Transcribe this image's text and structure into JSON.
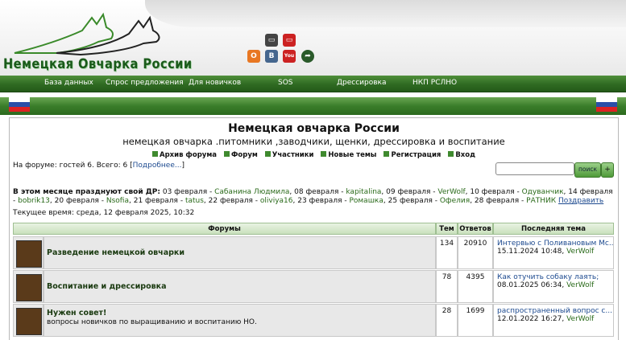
{
  "header": {
    "site_title": "Немецкая Овчарка России",
    "social_icons": [
      {
        "name": "tv-icon",
        "color": "#444444",
        "glyph": "▭"
      },
      {
        "name": "youtube-icon-top",
        "color": "#cc2222",
        "glyph": "▭"
      },
      {
        "name": "odnoklassniki-icon",
        "color": "#e87722",
        "glyph": "О"
      },
      {
        "name": "vkontakte-icon",
        "color": "#45668e",
        "glyph": "В"
      },
      {
        "name": "youtube-icon",
        "color": "#cc2222",
        "glyph": "You"
      },
      {
        "name": "share-icon",
        "color": "#2a5a2a",
        "glyph": "➦"
      }
    ]
  },
  "nav": {
    "items": [
      "База данных",
      "Спрос предложения",
      "Для новичков",
      "SOS",
      "Дрессировка",
      "НКП РСЛНО"
    ]
  },
  "forum": {
    "title": "Немецкая овчарка России",
    "description": "немецкая овчарка .питомники ,заводчики, щенки, дрессировка и воспитание",
    "top_links": [
      "Архив форума",
      "Форум",
      "Участники",
      "Новые темы",
      "Регистрация",
      "Вход"
    ],
    "online_text": "На форуме: гостей 6. Всего: 6 [",
    "online_more": "Подробнее...",
    "online_close": "]",
    "search_button": "поиск",
    "plus_button": "+",
    "birthdays_label": "В этом месяце празднуют свой ДР:",
    "birthdays": [
      {
        "date": "03 февраля",
        "user": "Сабанина Людмила"
      },
      {
        "date": "08 февраля",
        "user": "kapitalina"
      },
      {
        "date": "09 февраля",
        "user": "VerWolf"
      },
      {
        "date": "10 февраля",
        "user": "Одуванчик"
      },
      {
        "date": "14 февраля",
        "user": "bobrik13"
      },
      {
        "date": "20 февраля",
        "user": "Nsofia"
      },
      {
        "date": "21 февраля",
        "user": "tatus"
      },
      {
        "date": "22 февраля",
        "user": "oliviya16"
      },
      {
        "date": "23 февраля",
        "user": "Ромашка"
      },
      {
        "date": "25 февраля",
        "user": "Офелия"
      },
      {
        "date": "28 февраля",
        "user": "РАТНИК"
      }
    ],
    "congratulate": "Поздравить",
    "current_time": "Текущее время: среда, 12 февраля 2025, 10:32"
  },
  "table": {
    "headers": {
      "forums": "Форумы",
      "topics": "Тем",
      "replies": "Ответов",
      "last": "Последняя тема"
    },
    "rows": [
      {
        "name": "Разведение немецкой овчарки",
        "desc": "",
        "topics": "134",
        "replies": "20910",
        "last_topic": "Интервью с Поливановым Мс...",
        "last_date": "15.11.2024 10:48,",
        "last_user": "VerWolf"
      },
      {
        "name": "Воспитание и дрессировка",
        "desc": "",
        "topics": "78",
        "replies": "4395",
        "last_topic": "Как отучить собаку лаять;",
        "last_date": "08.01.2025 06:34,",
        "last_user": "VerWolf"
      },
      {
        "name": "Нужен совет!",
        "desc": "вопросы новичков по выращиванию и воспитанию НО.",
        "topics": "28",
        "replies": "1699",
        "last_topic": "распространенный вопрос с...",
        "last_date": "12.01.2022 16:27,",
        "last_user": "VerWolf"
      }
    ]
  },
  "colors": {
    "nav_green": "#2f6a22",
    "link_blue": "#1d4a8f",
    "user_green": "#2a6a1a"
  }
}
